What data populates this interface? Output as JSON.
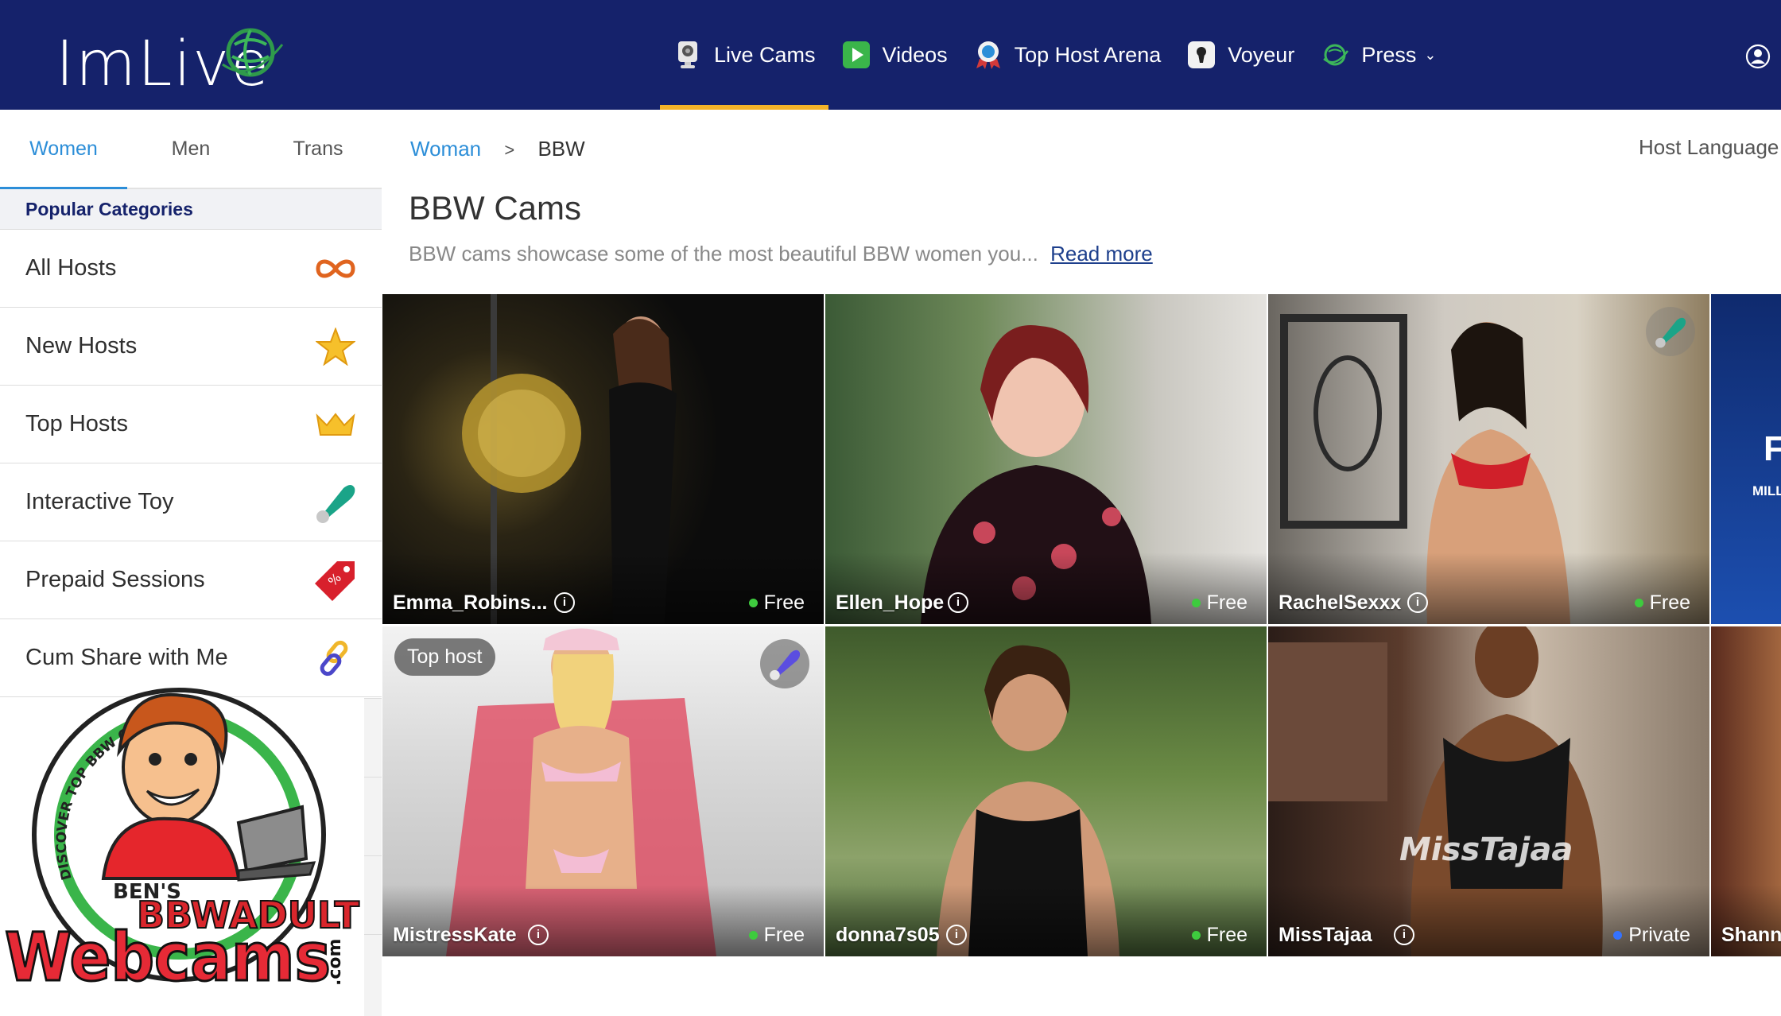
{
  "brand": {
    "logo_text": "ImLive"
  },
  "nav": {
    "items": [
      {
        "label": "Live Cams",
        "icon": "webcam-icon",
        "active": true
      },
      {
        "label": "Videos",
        "icon": "play-icon"
      },
      {
        "label": "Top Host Arena",
        "icon": "award-icon"
      },
      {
        "label": "Voyeur",
        "icon": "keyhole-icon"
      },
      {
        "label": "Press",
        "icon": "globe-icon",
        "dropdown": true,
        "caret": "⌄"
      }
    ],
    "user_icon": "user-icon"
  },
  "sidebar": {
    "tabs": [
      {
        "label": "Women",
        "active": true
      },
      {
        "label": "Men"
      },
      {
        "label": "Trans"
      }
    ],
    "section_title": "Popular Categories",
    "categories": [
      {
        "label": "All Hosts",
        "icon": "infinity-icon"
      },
      {
        "label": "New Hosts",
        "icon": "star-icon"
      },
      {
        "label": "Top Hosts",
        "icon": "crown-icon"
      },
      {
        "label": "Interactive Toy",
        "icon": "toy-icon"
      },
      {
        "label": "Prepaid Sessions",
        "icon": "tag-icon"
      },
      {
        "label": "Cum Share with Me",
        "icon": "link-icon"
      }
    ]
  },
  "badge": {
    "ring_text": "DISCOVER TOP BBW CAM SITES & MODELS!",
    "bens": "BEN'S",
    "bbw": "BBWADULT",
    "webcams": "Webcams",
    "com": ".com"
  },
  "breadcrumb": {
    "parent": "Woman",
    "separator": ">",
    "current": "BBW"
  },
  "host_language_label": "Host Language",
  "page": {
    "title": "BBW Cams",
    "description": "BBW cams showcase some of the most beautiful BBW women you...",
    "read_more": "Read more"
  },
  "hosts": [
    {
      "name": "Emma_Robins...",
      "status": "Free"
    },
    {
      "name": "Ellen_Hope",
      "status": "Free"
    },
    {
      "name": "RachelSexxx",
      "status": "Free",
      "toy": true
    },
    {
      "name": "MistressKate",
      "status": "Free",
      "tag": "Top host",
      "toy": true
    },
    {
      "name": "donna7s05",
      "status": "Free"
    },
    {
      "name": "MissTajaa",
      "status": "Private",
      "watermark": "MissTajaa"
    },
    {
      "name": "Shann",
      "status": ""
    }
  ],
  "promo_card": {
    "big_letter": "F",
    "small_text": "MILL"
  },
  "colors": {
    "nav_bg": "#15226b",
    "accent": "#f4b328",
    "link": "#2c8ed8",
    "free_dot": "#3ecb3e",
    "private_dot": "#3572ff"
  }
}
